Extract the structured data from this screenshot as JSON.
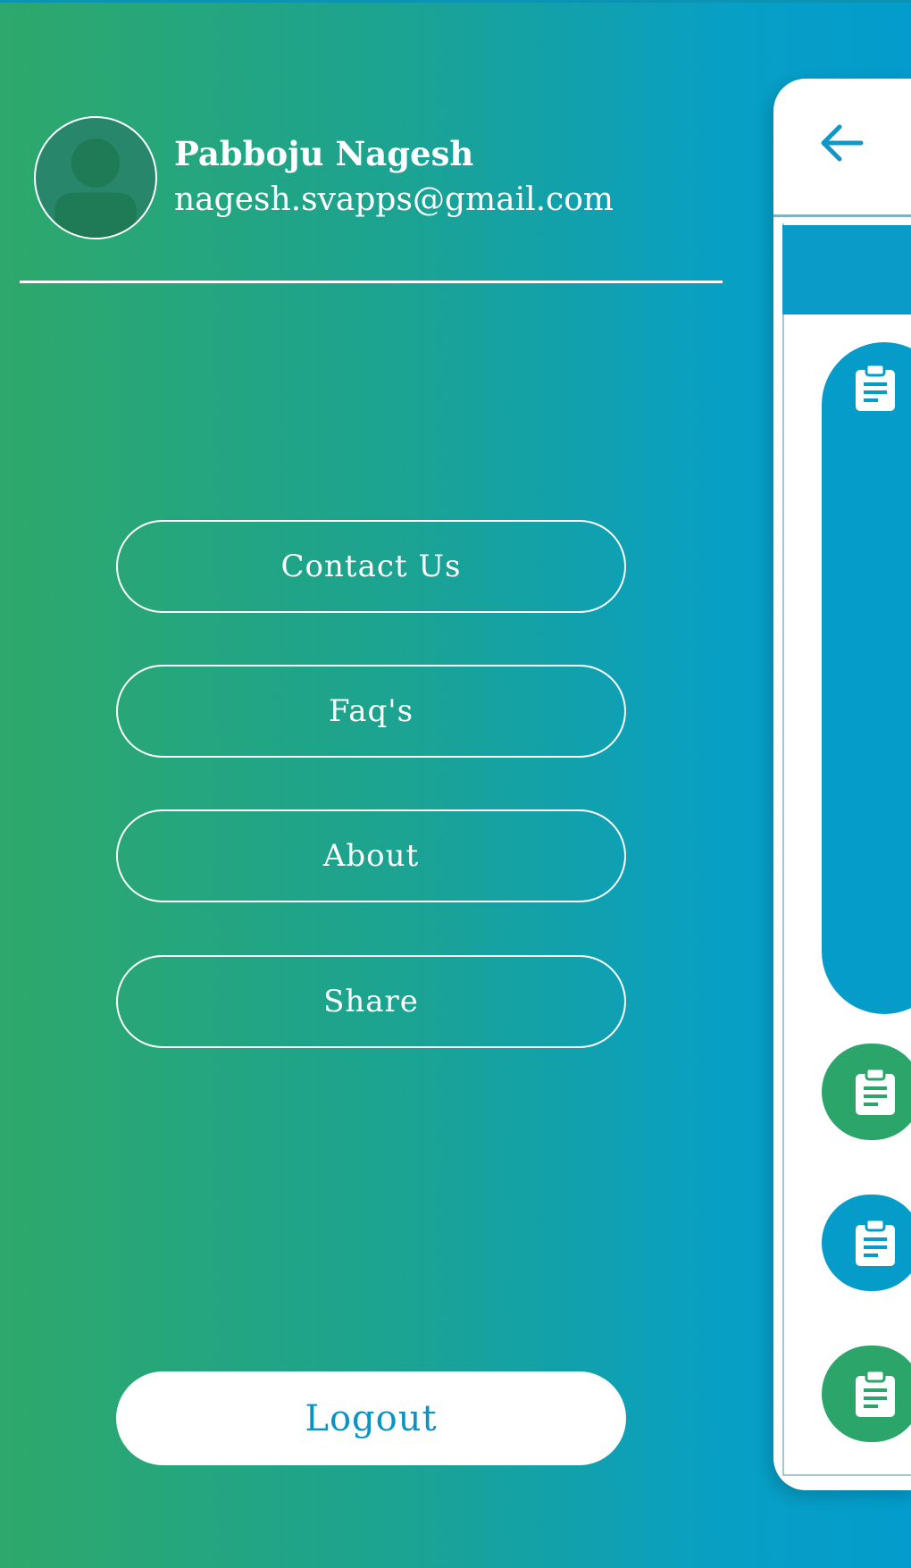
{
  "user": {
    "name": "Pabboju Nagesh",
    "email": "nagesh.svapps@gmail.com"
  },
  "menu": {
    "items": [
      {
        "label": "Contact Us"
      },
      {
        "label": "Faq's"
      },
      {
        "label": "About"
      },
      {
        "label": "Share"
      }
    ],
    "logout_label": "Logout"
  },
  "icons": {
    "avatar": "person-icon",
    "back": "arrow-left-icon",
    "list": "clipboard-icon"
  },
  "colors": {
    "gradient_start": "#2ea86b",
    "gradient_end": "#039ccc",
    "accent_blue": "#069cc9",
    "accent_green": "#2ba56a",
    "logout_text": "#0c93c4"
  }
}
